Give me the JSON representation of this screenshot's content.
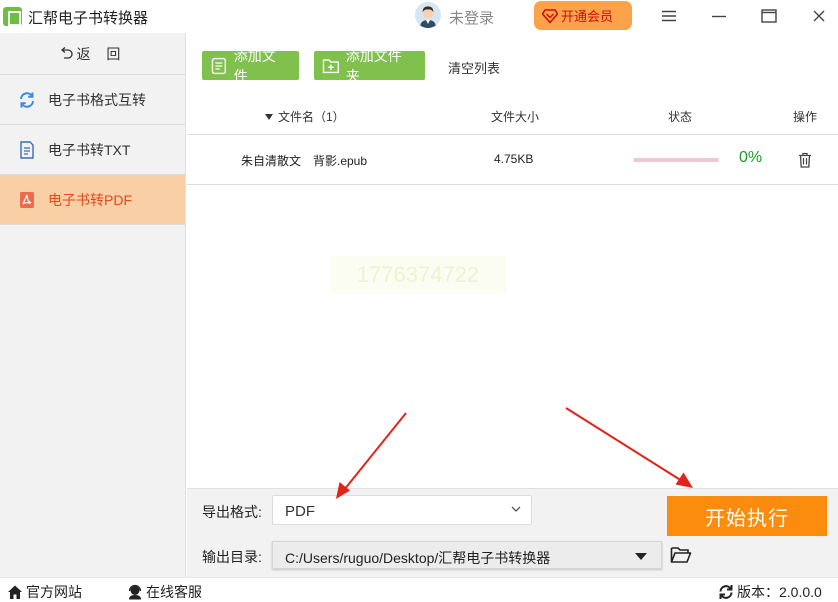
{
  "app": {
    "title": "汇帮电子书转换器",
    "login_text": "未登录",
    "vip_label": "开通会员"
  },
  "sidebar": {
    "back_label": "返 回",
    "items": [
      {
        "label": "电子书格式互转",
        "icon": "refresh-icon",
        "active": false
      },
      {
        "label": "电子书转TXT",
        "icon": "document-icon",
        "active": false
      },
      {
        "label": "电子书转PDF",
        "icon": "pdf-icon",
        "active": true
      }
    ]
  },
  "toolbar": {
    "add_file_label": "添加文件",
    "add_folder_label": "添加文件夹",
    "clear_label": "清空列表"
  },
  "table": {
    "headers": {
      "name": "文件名（1）",
      "size": "文件大小",
      "status": "状态",
      "actions": "操作"
    },
    "rows": [
      {
        "name": "朱自清散文　背影.epub",
        "size": "4.75KB",
        "progress_percent": 0,
        "status_text": "0%"
      }
    ]
  },
  "watermark_text": "1776374722",
  "bottom": {
    "format_label": "导出格式:",
    "format_value": "PDF",
    "output_label": "输出目录:",
    "output_value": "C:/Users/ruguo/Desktop/汇帮电子书转换器",
    "start_label": "开始执行"
  },
  "statusbar": {
    "site_label": "官方网站",
    "service_label": "在线客服",
    "version_label": "版本：2.0.0.0"
  },
  "colors": {
    "accent_green": "#80c14d",
    "accent_orange": "#fb8c0d",
    "active_nav_bg": "#f9cfa6",
    "active_nav_text": "#e4481b",
    "annotation_arrow": "#e2231a"
  }
}
